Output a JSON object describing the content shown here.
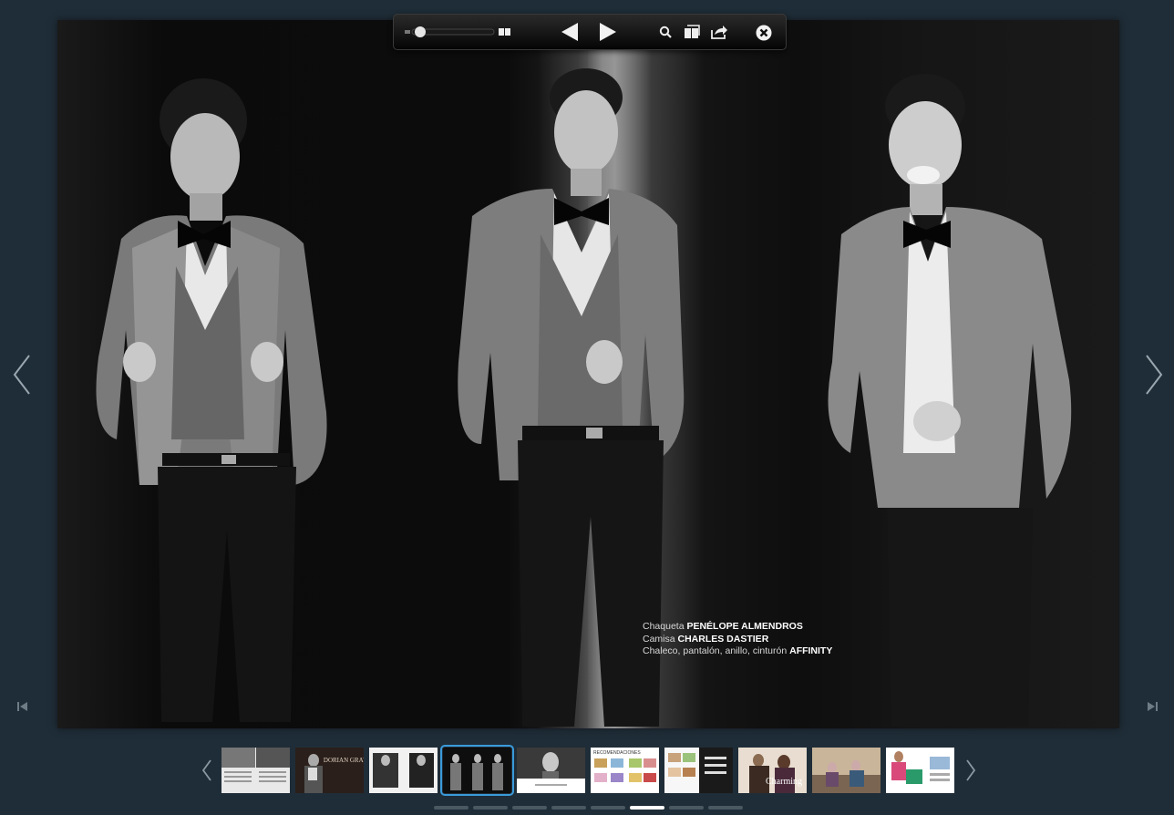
{
  "toolbar": {
    "zoom_percent": 0,
    "items": [
      {
        "name": "zoom-slider",
        "icon": "slider"
      },
      {
        "name": "two-page-view",
        "icon": "two-page-icon"
      },
      {
        "name": "previous-page",
        "icon": "triangle-left-icon"
      },
      {
        "name": "next-page",
        "icon": "triangle-right-icon"
      },
      {
        "name": "search",
        "icon": "search-icon"
      },
      {
        "name": "thumbnails",
        "icon": "pages-icon"
      },
      {
        "name": "share",
        "icon": "share-icon"
      },
      {
        "name": "close",
        "icon": "close-icon"
      }
    ]
  },
  "credits": {
    "line1_prefix": "Chaqueta ",
    "line1_brand": "PENÉLOPE ALMENDROS",
    "line2_prefix": "Camisa ",
    "line2_brand": "CHARLES DASTIER",
    "line3_prefix": "Chaleco, pantalón, anillo, cinturón ",
    "line3_brand": "AFFINITY"
  },
  "thumbnails": {
    "count": 10,
    "active_index": 3,
    "texts": [
      "",
      "DORIAN GRAY",
      "",
      "",
      "",
      "RECOMENDACIONES",
      "",
      "Charming",
      "",
      ""
    ]
  },
  "pagination": {
    "count": 8,
    "active_index": 5
  },
  "colors": {
    "background": "#1f2d38",
    "accent": "#3a9ad9",
    "toolbar": "#0a0a0a"
  }
}
